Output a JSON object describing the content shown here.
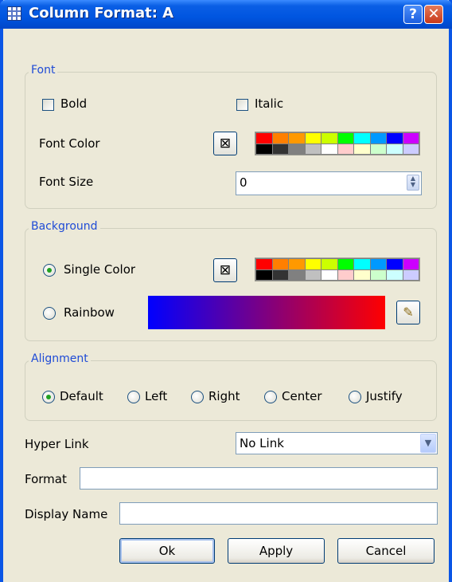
{
  "window": {
    "title": "Column Format: A",
    "help_label": "?",
    "close_label": "✕"
  },
  "font": {
    "legend": "Font",
    "bold_label": "Bold",
    "bold_checked": false,
    "italic_label": "Italic",
    "italic_checked": false,
    "color_label": "Font Color",
    "color_button_glyph": "⊠",
    "size_label": "Font Size",
    "size_value": "0"
  },
  "palette": {
    "colors": [
      "#ff0000",
      "#ff7f00",
      "#ff9900",
      "#ffff00",
      "#ccff00",
      "#00ff00",
      "#00ffff",
      "#0099ff",
      "#0000ff",
      "#cc00ff",
      "#000000",
      "#333333",
      "#808080",
      "#c0c0c0",
      "#ffffff",
      "#ffcccc",
      "#ffffcc",
      "#ccffcc",
      "#ccffff",
      "#ccccff"
    ]
  },
  "background": {
    "legend": "Background",
    "single_label": "Single Color",
    "single_checked": true,
    "rainbow_label": "Rainbow",
    "rainbow_checked": false,
    "color_button_glyph": "⊠",
    "rainbow_from": "#0000ff",
    "rainbow_to": "#ff0000",
    "edit_glyph": "✎"
  },
  "alignment": {
    "legend": "Alignment",
    "options": [
      {
        "label": "Default",
        "checked": true
      },
      {
        "label": "Left",
        "checked": false
      },
      {
        "label": "Right",
        "checked": false
      },
      {
        "label": "Center",
        "checked": false
      },
      {
        "label": "Justify",
        "checked": false
      }
    ]
  },
  "hyperlink": {
    "label": "Hyper Link",
    "value": "No Link",
    "arrow": "▼"
  },
  "format": {
    "label": "Format",
    "value": ""
  },
  "display_name": {
    "label": "Display Name",
    "value": ""
  },
  "buttons": {
    "ok": "Ok",
    "apply": "Apply",
    "cancel": "Cancel"
  },
  "colors": {
    "titlebar": "#0055e0",
    "dialog_bg": "#ece9d8",
    "legend_text": "#1f4bd6",
    "radio_dot": "#21a121"
  }
}
